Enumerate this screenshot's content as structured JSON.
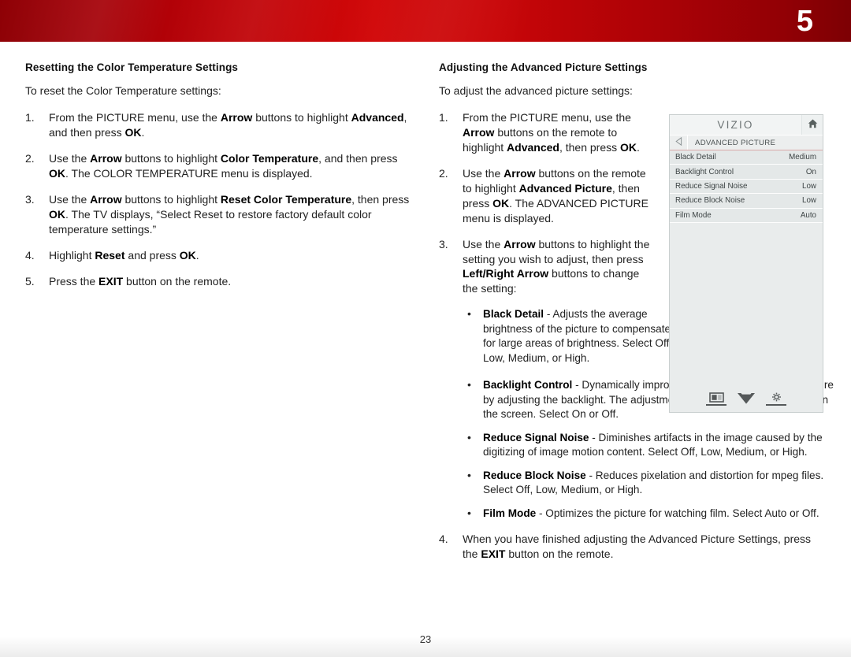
{
  "banner": {
    "chapter": "5"
  },
  "left": {
    "heading": "Resetting the Color Temperature Settings",
    "intro": "To reset the Color Temperature settings:",
    "steps": [
      {
        "num": "1.",
        "html": "From the PICTURE menu, use the <b>Arrow</b> buttons to highlight <b>Advanced</b>, and then press <b>OK</b>."
      },
      {
        "num": "2.",
        "html": "Use the <b>Arrow</b> buttons to highlight <b>Color Temperature</b>, and then press <b>OK</b>. The COLOR TEMPERATURE menu is displayed."
      },
      {
        "num": "3.",
        "html": "Use the <b>Arrow</b> buttons to highlight <b>Reset Color Temperature</b>, then press <b>OK</b>. The TV displays, “Select Reset to restore factory default color temperature settings.”"
      },
      {
        "num": "4.",
        "html": "Highlight <b>Reset</b> and press <b>OK</b>."
      },
      {
        "num": "5.",
        "html": "Press the <b>EXIT</b> button on the remote."
      }
    ]
  },
  "right": {
    "heading": "Adjusting the Advanced Picture Settings",
    "intro": "To adjust the advanced picture settings:",
    "steps": [
      {
        "num": "1.",
        "html": "From the PICTURE menu, use the <b>Arrow</b> buttons on the remote to highlight <b>Advanced</b>, then press <b>OK</b>."
      },
      {
        "num": "2.",
        "html": "Use the <b>Arrow</b> buttons on the remote to highlight <b>Advanced Picture</b>, then press <b>OK</b>. The ADVANCED PICTURE menu is displayed."
      },
      {
        "num": "3.",
        "html": "Use the <b>Arrow</b> buttons to highlight the setting you wish to adjust, then press <b>Left/Right Arrow</b> buttons to change the setting:"
      }
    ],
    "bullets_narrow": [
      {
        "html": "<b>Black Detail</b> - Adjusts the average brightness of the picture to compensate for large areas of brightness. Select Off, Low, Medium, or High."
      }
    ],
    "bullets_wide": [
      {
        "html": "<b>Backlight Control</b> - Dynamically improves the contrast ratio of the picture by adjusting the backlight. The adjustment is controlled by the content on the screen. Select On or Off."
      },
      {
        "html": "<b>Reduce Signal Noise</b> - Diminishes artifacts in the image caused by the digitizing of image motion content. Select Off, Low, Medium, or High."
      },
      {
        "html": "<b>Reduce Block Noise</b> - Reduces pixelation and distortion for mpeg files. Select Off, Low, Medium, or High."
      },
      {
        "html": "<b>Film Mode</b> - Optimizes the picture for watching film. Select Auto or Off."
      }
    ],
    "final_step": {
      "num": "4.",
      "html": "When you have finished adjusting the Advanced Picture Settings, press the <b>EXIT</b> button on the remote."
    }
  },
  "tv_menu": {
    "brand": "VIZIO",
    "breadcrumb": "ADVANCED PICTURE",
    "rows": [
      {
        "label": "Black Detail",
        "value": "Medium"
      },
      {
        "label": "Backlight Control",
        "value": "On"
      },
      {
        "label": "Reduce Signal Noise",
        "value": "Low"
      },
      {
        "label": "Reduce Block Noise",
        "value": "Low"
      },
      {
        "label": "Film Mode",
        "value": "Auto"
      }
    ],
    "footer_icons": [
      "picture-icon",
      "vizio-v-icon",
      "settings-gear-icon"
    ],
    "home_icon": "home-icon",
    "back_icon": "back-arrow-icon"
  },
  "footer": {
    "page_number": "23"
  },
  "colors": {
    "banner_red": "#c90608",
    "banner_red_dark": "#8e0005",
    "menu_bg": "#e9ecec",
    "menu_row": "#e4e8e8",
    "menu_text": "#3d4445"
  }
}
